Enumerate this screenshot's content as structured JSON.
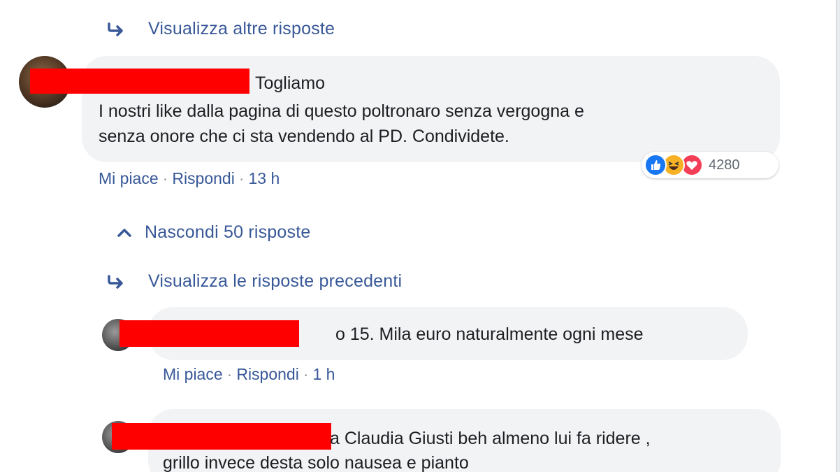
{
  "thread": {
    "view_more_replies": "Visualizza altre risposte",
    "hide_replies": "Nascondi 50 risposte",
    "view_previous_replies": "Visualizza le risposte precedenti"
  },
  "comments": [
    {
      "text_line1": "Togliamo",
      "text_line2": "I nostri like dalla pagina di questo poltronaro senza vergogna e",
      "text_line3": "senza onore che ci sta vendendo al PD. Condividete.",
      "like_label": "Mi piace",
      "reply_label": "Rispondi",
      "time": "13 h",
      "reaction_count": "4280",
      "reaction_icons": [
        "like-icon",
        "haha-icon",
        "love-icon"
      ]
    },
    {
      "text_line1": "o 15. Mila euro naturalmente ogni mese",
      "like_label": "Mi piace",
      "reply_label": "Rispondi",
      "time": "1 h"
    },
    {
      "text_line1": "a Claudia Giusti beh almeno lui fa ridere ,",
      "text_line2": "grillo invece desta solo nausea e pianto"
    }
  ],
  "colors": {
    "link": "#385898",
    "bubble": "#f2f3f5",
    "redaction": "#ff0000"
  }
}
